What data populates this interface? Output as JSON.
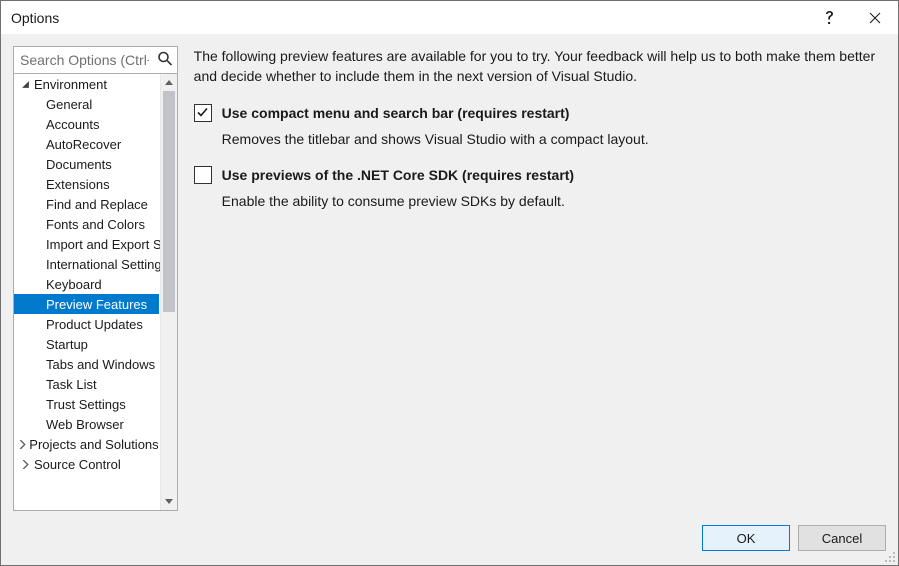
{
  "window": {
    "title": "Options"
  },
  "search": {
    "placeholder": "Search Options (Ctrl+E)"
  },
  "tree": {
    "top": [
      {
        "label": "Environment",
        "expanded": true,
        "children": [
          "General",
          "Accounts",
          "AutoRecover",
          "Documents",
          "Extensions",
          "Find and Replace",
          "Fonts and Colors",
          "Import and Export Settings",
          "International Settings",
          "Keyboard",
          "Preview Features",
          "Product Updates",
          "Startup",
          "Tabs and Windows",
          "Task List",
          "Trust Settings",
          "Web Browser"
        ],
        "selected": "Preview Features"
      },
      {
        "label": "Projects and Solutions",
        "expanded": false
      },
      {
        "label": "Source Control",
        "expanded": false
      }
    ]
  },
  "content": {
    "intro": "The following preview features are available for you to try. Your feedback will help us to both make them better and decide whether to include them in the next version of Visual Studio.",
    "options": [
      {
        "checked": true,
        "title": "Use compact menu and search bar (requires restart)",
        "desc": "Removes the titlebar and shows Visual Studio with a compact layout."
      },
      {
        "checked": false,
        "title": "Use previews of the .NET Core SDK (requires restart)",
        "desc": "Enable the ability to consume preview SDKs by default."
      }
    ]
  },
  "buttons": {
    "ok": "OK",
    "cancel": "Cancel"
  }
}
